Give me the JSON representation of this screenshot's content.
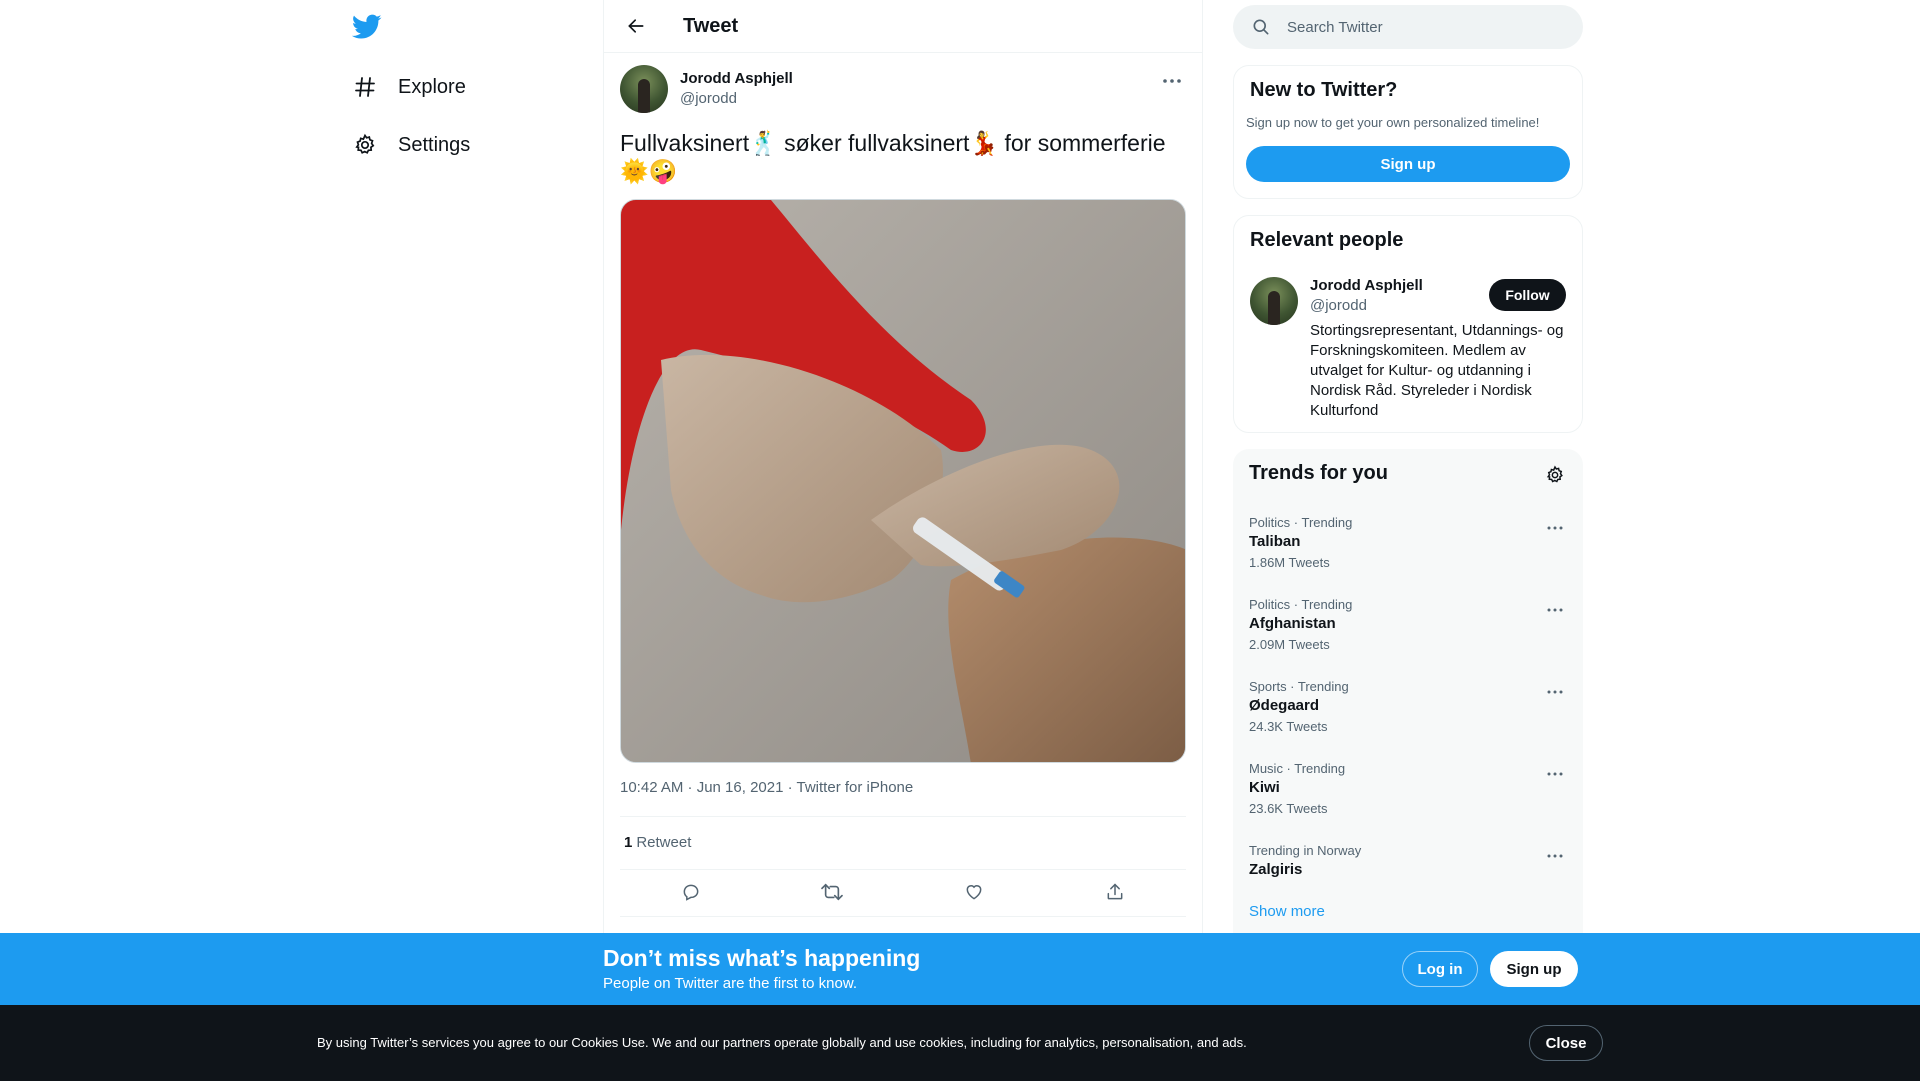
{
  "nav": {
    "logo_icon": "twitter-bird-icon",
    "items": [
      {
        "label": "Explore",
        "icon": "hashtag-icon"
      },
      {
        "label": "Settings",
        "icon": "gear-icon"
      }
    ]
  },
  "header": {
    "title": "Tweet"
  },
  "tweet": {
    "author_name": "Jorodd Asphjell",
    "author_handle": "@jorodd",
    "text": "Fullvaksinert🕺 søker fullvaksinert💃 for sommerferie 🌞🤪",
    "timestamp": "10:42 AM · Jun 16, 2021",
    "separator": " · ",
    "source": "Twitter for iPhone",
    "retweet_count": "1",
    "retweet_label": "Retweet"
  },
  "search": {
    "placeholder": "Search Twitter"
  },
  "new_to_twitter": {
    "title": "New to Twitter?",
    "subtitle": "Sign up now to get your own personalized timeline!",
    "signup_label": "Sign up"
  },
  "relevant_people": {
    "title": "Relevant people",
    "name": "Jorodd Asphjell",
    "handle": "@jorodd",
    "follow_label": "Follow",
    "bio": "Stortingsrepresentant, Utdannings- og Forskningskomiteen. Medlem av utvalget for Kultur- og utdanning i Nordisk Råd. Styreleder i Nordisk Kulturfond"
  },
  "trends": {
    "title": "Trends for you",
    "items": [
      {
        "context": "Politics · Trending",
        "name": "Taliban",
        "count": "1.86M Tweets"
      },
      {
        "context": "Politics · Trending",
        "name": "Afghanistan",
        "count": "2.09M Tweets"
      },
      {
        "context": "Sports · Trending",
        "name": "Ødegaard",
        "count": "24.3K Tweets"
      },
      {
        "context": "Music · Trending",
        "name": "Kiwi",
        "count": "23.6K Tweets"
      },
      {
        "context": "Trending in Norway",
        "name": "Zalgiris",
        "count": ""
      }
    ],
    "show_more": "Show more"
  },
  "banner": {
    "title": "Don’t miss what’s happening",
    "subtitle": "People on Twitter are the first to know.",
    "login_label": "Log in",
    "signup_label": "Sign up"
  },
  "cookie": {
    "text": "By using Twitter’s services you agree to our Cookies Use. We and our partners operate globally and use cookies, including for analytics, personalisation, and ads.",
    "close_label": "Close"
  },
  "colors": {
    "accent": "#1d9bf0",
    "text": "#0f1419",
    "muted": "#536471",
    "dark": "#0f1419"
  }
}
